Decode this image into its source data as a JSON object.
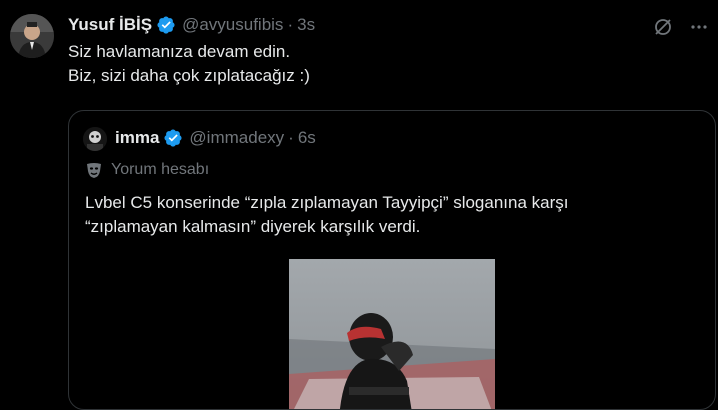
{
  "tweet": {
    "name": "Yusuf İBİŞ",
    "handle": "@avyusufibis",
    "dot": "·",
    "time": "3s",
    "lines": [
      "Siz havlamanıza devam edin.",
      "Biz, sizi daha çok zıplatacağız :)"
    ]
  },
  "quoted": {
    "name": "imma",
    "handle": "@immadexy",
    "dot": "·",
    "time": "6s",
    "label": "Yorum hesabı",
    "lines": [
      "Lvbel C5 konserinde “zıpla zıplamayan Tayyipçi” sloganına karşı",
      "“zıplamayan kalmasın” diyerek karşılık verdi."
    ]
  },
  "icons": {
    "verified": "verified-badge-icon",
    "grok": "grok-icon",
    "more": "more-icon",
    "mask": "theater-mask-icon"
  },
  "colors": {
    "background": "#000000",
    "text": "#e7e9ea",
    "muted": "#71767b",
    "verified": "#1d9bf0",
    "border": "#2f3336"
  }
}
